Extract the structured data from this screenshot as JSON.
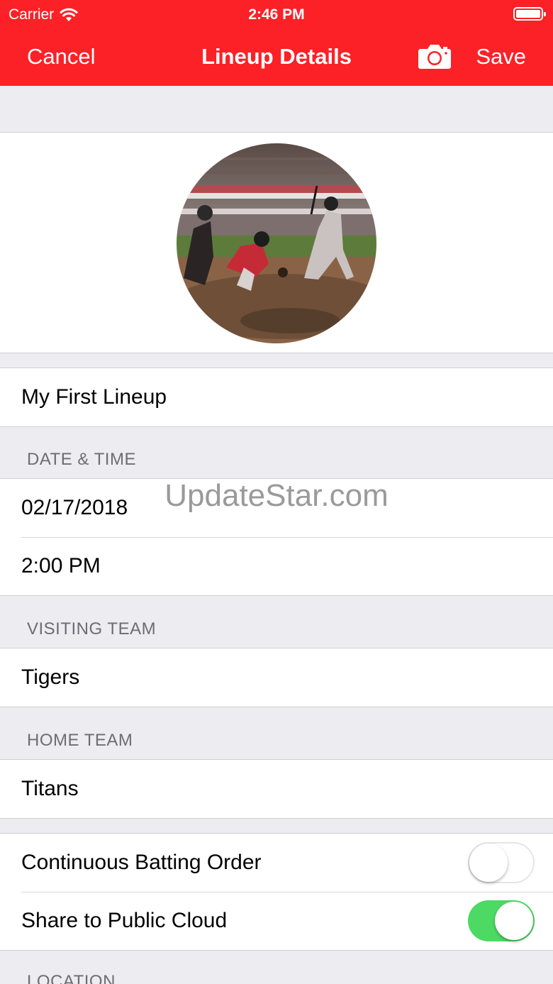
{
  "status_bar": {
    "carrier": "Carrier",
    "time": "2:46 PM"
  },
  "nav": {
    "cancel_label": "Cancel",
    "title": "Lineup Details",
    "camera_icon": "camera-icon",
    "save_label": "Save"
  },
  "lineup_name": "My First Lineup",
  "date_time": {
    "header": "DATE & TIME",
    "date": "02/17/2018",
    "time": "2:00 PM"
  },
  "visiting_team": {
    "header": "VISITING TEAM",
    "value": "Tigers"
  },
  "home_team": {
    "header": "HOME TEAM",
    "value": "Titans"
  },
  "options": [
    {
      "label": "Continuous Batting Order",
      "enabled": false
    },
    {
      "label": "Share to Public Cloud",
      "enabled": true
    }
  ],
  "location": {
    "header": "LOCATION"
  },
  "watermark": "UpdateStar.com",
  "colors": {
    "accent": "#fb2127",
    "toggle_on": "#4cd964",
    "background": "#ececf1",
    "header_text": "#6d6d72"
  }
}
